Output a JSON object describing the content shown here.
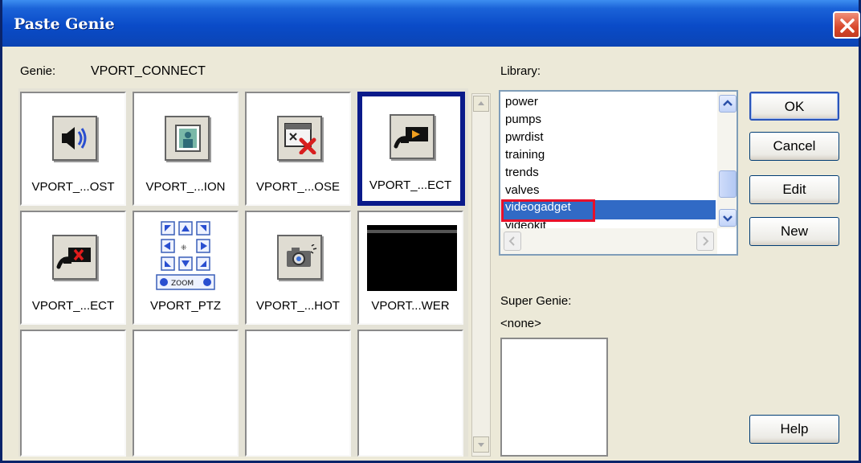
{
  "window": {
    "title": "Paste Genie"
  },
  "genie": {
    "label": "Genie:",
    "value": "VPORT_CONNECT",
    "cells": [
      {
        "label": "VPORT_...OST",
        "icon": "speaker-icon"
      },
      {
        "label": "VPORT_...ION",
        "icon": "portrait-icon"
      },
      {
        "label": "VPORT_...OSE",
        "icon": "close-window-icon"
      },
      {
        "label": "VPORT_...ECT",
        "icon": "camera-connect-icon",
        "selected": true
      },
      {
        "label": "VPORT_...ECT",
        "icon": "camera-disconnect-icon"
      },
      {
        "label": "VPORT_PTZ",
        "icon": "ptz-control-icon",
        "zoom_text": "ZOOM"
      },
      {
        "label": "VPORT_...HOT",
        "icon": "snapshot-icon"
      },
      {
        "label": "VPORT...WER",
        "icon": "video-viewer-icon"
      }
    ]
  },
  "library": {
    "label": "Library:",
    "items": [
      "power",
      "pumps",
      "pwrdist",
      "training",
      "trends",
      "valves",
      "videogadget",
      "videokit"
    ],
    "selected": "videogadget"
  },
  "super_genie": {
    "label": "Super Genie:",
    "value": "<none>"
  },
  "buttons": {
    "ok": "OK",
    "cancel": "Cancel",
    "edit": "Edit",
    "new": "New",
    "help": "Help"
  },
  "colors": {
    "titlebar": "#0a4bc8",
    "selection": "#316ac5",
    "highlight_border": "#e8102a",
    "selected_cell_border": "#0a1a8a"
  }
}
